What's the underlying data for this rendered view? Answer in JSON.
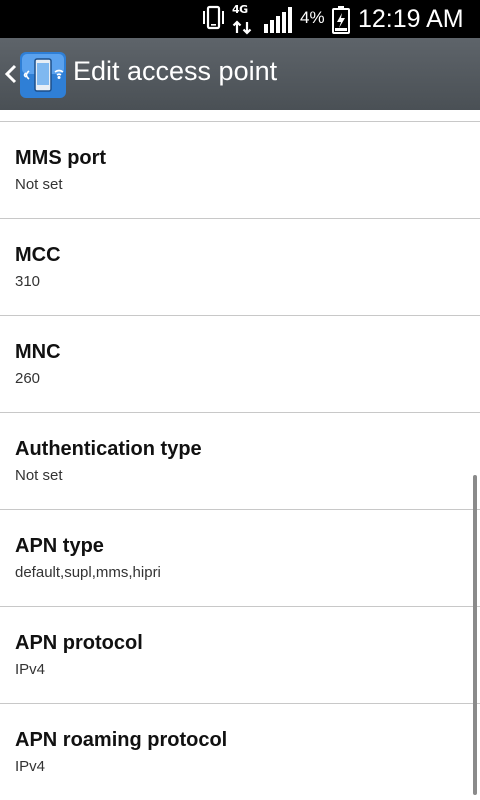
{
  "status_bar": {
    "network_type": "4G",
    "battery_percent": "4%",
    "time": "12:19 AM",
    "icons": [
      "vibrate-icon",
      "4g-data-icon",
      "signal-strength-icon",
      "battery-charging-icon"
    ],
    "signal_bars": 5
  },
  "action_bar": {
    "title": "Edit access point",
    "back_icon": "chevron-left-icon",
    "app_icon": "mobile-network-settings-icon",
    "background_color": "#53595e"
  },
  "preferences": [
    {
      "title": "MMS port",
      "summary": "Not set"
    },
    {
      "title": "MCC",
      "summary": "310"
    },
    {
      "title": "MNC",
      "summary": "260"
    },
    {
      "title": "Authentication type",
      "summary": "Not set"
    },
    {
      "title": "APN type",
      "summary": "default,supl,mms,hipri"
    },
    {
      "title": "APN protocol",
      "summary": "IPv4"
    },
    {
      "title": "APN roaming protocol",
      "summary": "IPv4"
    }
  ]
}
